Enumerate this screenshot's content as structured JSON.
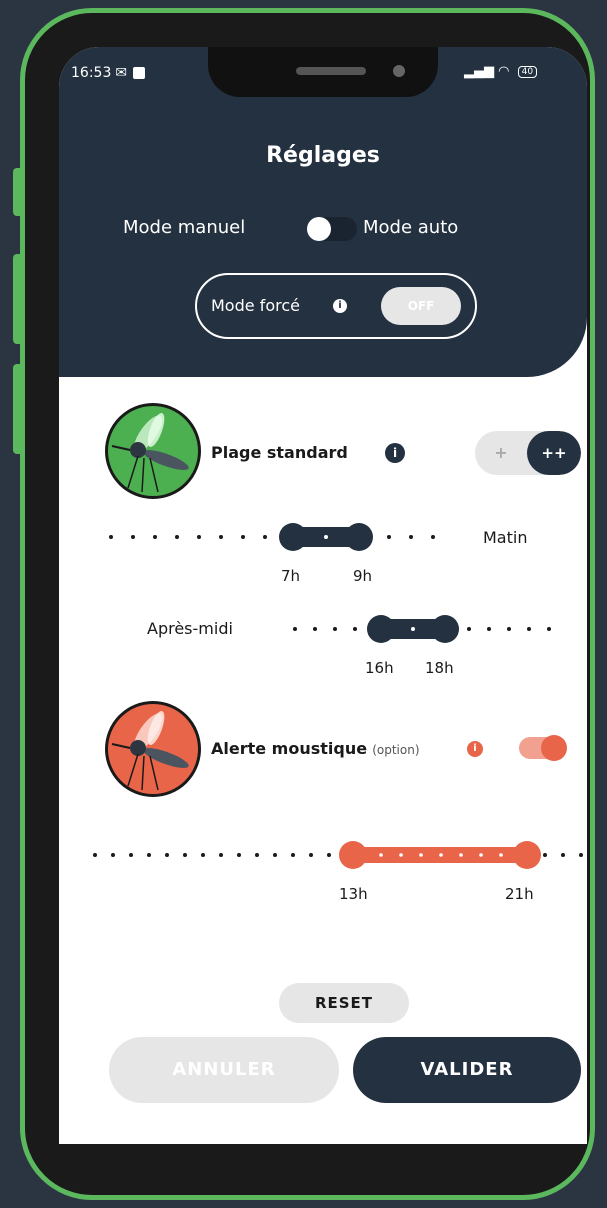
{
  "status_bar": {
    "time": "16:53",
    "battery": "40"
  },
  "header": {
    "title": "Réglages",
    "mode_manual": "Mode manuel",
    "mode_auto": "Mode auto",
    "mode_force": "Mode forcé",
    "force_state": "OFF"
  },
  "standard": {
    "label": "Plage standard",
    "seg_plus": "+",
    "seg_plusplus": "++",
    "morning_label": "Matin",
    "morning_start": "7h",
    "morning_end": "9h",
    "afternoon_label": "Après-midi",
    "afternoon_start": "16h",
    "afternoon_end": "18h"
  },
  "alert": {
    "label": "Alerte moustique",
    "option": "(option)",
    "enabled": true,
    "start": "13h",
    "end": "21h"
  },
  "actions": {
    "reset": "RESET",
    "cancel": "ANNULER",
    "validate": "VALIDER"
  },
  "colors": {
    "navy": "#233140",
    "green": "#5cb85c",
    "orange": "#e8654a",
    "frame": "#5cb85c"
  },
  "icons": {
    "info": "info-icon",
    "mosquito": "mosquito-icon"
  }
}
